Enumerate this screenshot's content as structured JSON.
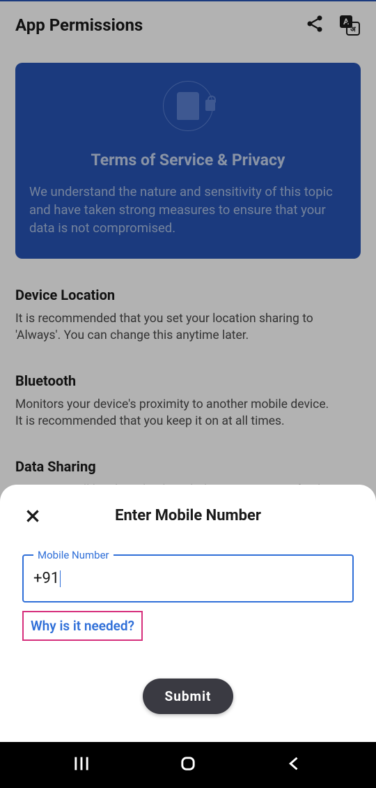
{
  "header": {
    "title": "App Permissions"
  },
  "terms_card": {
    "title": "Terms of Service & Privacy",
    "description": "We understand the nature and sensitivity of this topic and have taken strong measures to ensure that your data is not compromised."
  },
  "sections": [
    {
      "title": "Device Location",
      "description": "It is recommended that you set your location sharing to 'Always'. You can change this anytime later."
    },
    {
      "title": "Bluetooth",
      "description": "Monitors your device's proximity to another mobile device.\nIt is recommended that you keep it on at all times."
    },
    {
      "title": "Data Sharing",
      "description": "Your Data will be shared only with the Government of India"
    }
  ],
  "modal": {
    "title": "Enter Mobile Number",
    "input_label": "Mobile Number",
    "input_value": "+91",
    "why_link": "Why is it needed?",
    "submit_label": "Submit"
  }
}
